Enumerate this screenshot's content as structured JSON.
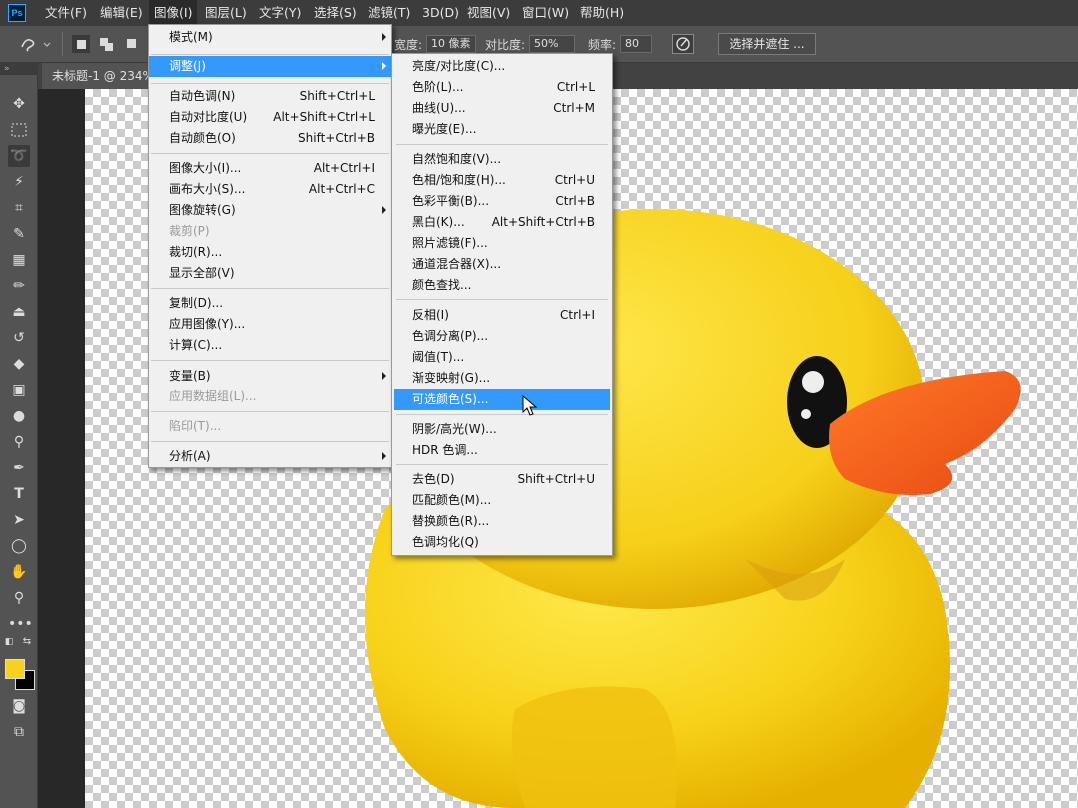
{
  "app": {
    "logo": "Ps"
  },
  "menubar": [
    {
      "label": "文件(F)"
    },
    {
      "label": "编辑(E)"
    },
    {
      "label": "图像(I)"
    },
    {
      "label": "图层(L)"
    },
    {
      "label": "文字(Y)"
    },
    {
      "label": "选择(S)"
    },
    {
      "label": "滤镜(T)"
    },
    {
      "label": "3D(D)"
    },
    {
      "label": "视图(V)"
    },
    {
      "label": "窗口(W)"
    },
    {
      "label": "帮助(H)"
    }
  ],
  "options": {
    "width_label": "宽度:",
    "width_value": "10 像素",
    "contrast_label": "对比度:",
    "contrast_value": "50%",
    "frequency_label": "频率:",
    "frequency_value": "80",
    "select_mask": "选择并遮住 ..."
  },
  "document": {
    "tab_title": "未标题-1 @ 234%"
  },
  "colors": {
    "foreground": "#f6d21c",
    "background": "#000000",
    "highlight": "#3399ff"
  },
  "image_menu": [
    {
      "label": "模式(M)",
      "shortcut": "",
      "submenu": true
    },
    {
      "label": "调整(J)",
      "shortcut": "",
      "submenu": true,
      "highlighted": true
    },
    {
      "label": "自动色调(N)",
      "shortcut": "Shift+Ctrl+L"
    },
    {
      "label": "自动对比度(U)",
      "shortcut": "Alt+Shift+Ctrl+L"
    },
    {
      "label": "自动颜色(O)",
      "shortcut": "Shift+Ctrl+B"
    },
    {
      "label": "图像大小(I)...",
      "shortcut": "Alt+Ctrl+I"
    },
    {
      "label": "画布大小(S)...",
      "shortcut": "Alt+Ctrl+C"
    },
    {
      "label": "图像旋转(G)",
      "shortcut": "",
      "submenu": true
    },
    {
      "label": "裁剪(P)",
      "shortcut": "",
      "disabled": true
    },
    {
      "label": "裁切(R)...",
      "shortcut": ""
    },
    {
      "label": "显示全部(V)",
      "shortcut": ""
    },
    {
      "label": "复制(D)...",
      "shortcut": ""
    },
    {
      "label": "应用图像(Y)...",
      "shortcut": ""
    },
    {
      "label": "计算(C)...",
      "shortcut": ""
    },
    {
      "label": "变量(B)",
      "shortcut": "",
      "submenu": true
    },
    {
      "label": "应用数据组(L)...",
      "shortcut": "",
      "disabled": true
    },
    {
      "label": "陷印(T)...",
      "shortcut": "",
      "disabled": true
    },
    {
      "label": "分析(A)",
      "shortcut": "",
      "submenu": true
    }
  ],
  "adjust_menu": [
    {
      "label": "亮度/对比度(C)...",
      "shortcut": ""
    },
    {
      "label": "色阶(L)...",
      "shortcut": "Ctrl+L"
    },
    {
      "label": "曲线(U)...",
      "shortcut": "Ctrl+M"
    },
    {
      "label": "曝光度(E)...",
      "shortcut": ""
    },
    {
      "label": "自然饱和度(V)...",
      "shortcut": ""
    },
    {
      "label": "色相/饱和度(H)...",
      "shortcut": "Ctrl+U"
    },
    {
      "label": "色彩平衡(B)...",
      "shortcut": "Ctrl+B"
    },
    {
      "label": "黑白(K)...",
      "shortcut": "Alt+Shift+Ctrl+B"
    },
    {
      "label": "照片滤镜(F)...",
      "shortcut": ""
    },
    {
      "label": "通道混合器(X)...",
      "shortcut": ""
    },
    {
      "label": "颜色查找...",
      "shortcut": ""
    },
    {
      "label": "反相(I)",
      "shortcut": "Ctrl+I"
    },
    {
      "label": "色调分离(P)...",
      "shortcut": ""
    },
    {
      "label": "阈值(T)...",
      "shortcut": ""
    },
    {
      "label": "渐变映射(G)...",
      "shortcut": ""
    },
    {
      "label": "可选颜色(S)...",
      "shortcut": "",
      "highlighted": true
    },
    {
      "label": "阴影/高光(W)...",
      "shortcut": ""
    },
    {
      "label": "HDR 色调...",
      "shortcut": ""
    },
    {
      "label": "去色(D)",
      "shortcut": "Shift+Ctrl+U"
    },
    {
      "label": "匹配颜色(M)...",
      "shortcut": ""
    },
    {
      "label": "替换颜色(R)...",
      "shortcut": ""
    },
    {
      "label": "色调均化(Q)",
      "shortcut": ""
    }
  ],
  "tools": [
    {
      "icon": "move-icon"
    },
    {
      "icon": "marquee-icon"
    },
    {
      "icon": "lasso-icon"
    },
    {
      "icon": "magic-wand-icon"
    },
    {
      "icon": "crop-icon"
    },
    {
      "icon": "eyedropper-icon"
    },
    {
      "icon": "healing-brush-icon"
    },
    {
      "icon": "brush-icon"
    },
    {
      "icon": "clone-stamp-icon"
    },
    {
      "icon": "history-brush-icon"
    },
    {
      "icon": "eraser-icon"
    },
    {
      "icon": "gradient-icon"
    },
    {
      "icon": "blur-icon"
    },
    {
      "icon": "dodge-icon"
    },
    {
      "icon": "pen-icon"
    },
    {
      "icon": "type-icon"
    },
    {
      "icon": "path-selection-icon"
    },
    {
      "icon": "ellipse-icon"
    },
    {
      "icon": "hand-icon"
    },
    {
      "icon": "zoom-icon"
    },
    {
      "icon": "more-tools-icon"
    }
  ]
}
